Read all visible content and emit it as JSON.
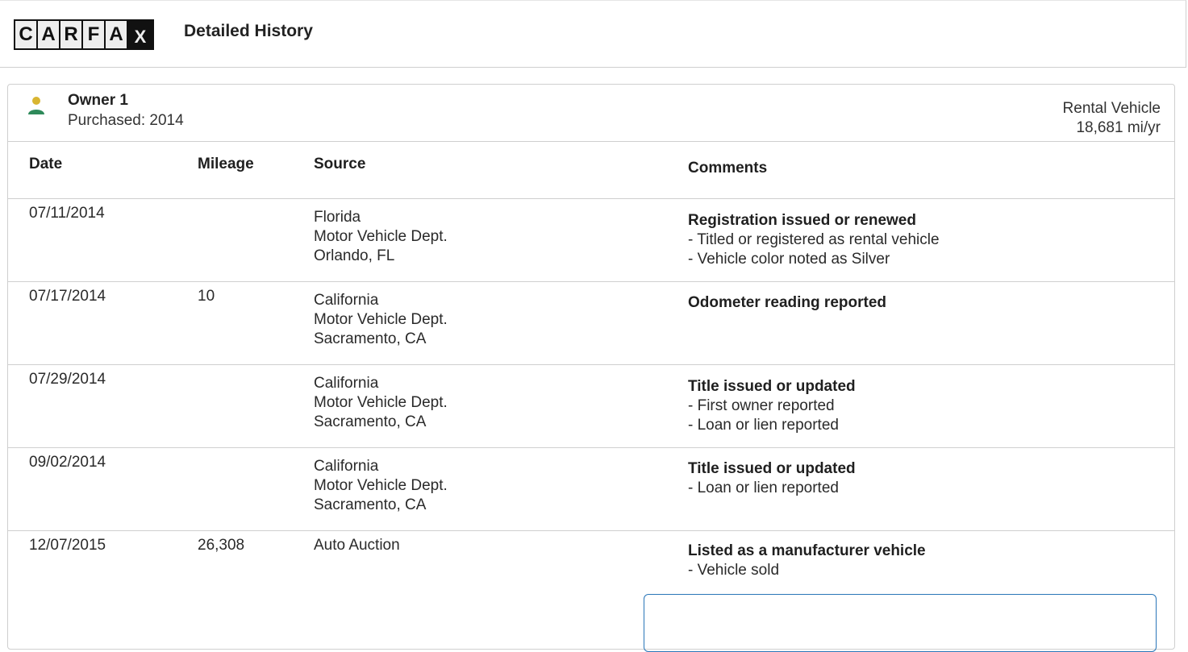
{
  "header": {
    "logo_letters": [
      "C",
      "A",
      "R",
      "F",
      "A",
      "X"
    ],
    "title": "Detailed History"
  },
  "owner": {
    "name": "Owner 1",
    "purchased": "Purchased: 2014",
    "type": "Rental Vehicle",
    "rate": "18,681 mi/yr",
    "icon": "person-icon",
    "icon_colors": {
      "head": "#d9b531",
      "body": "#2e8a5a"
    }
  },
  "table": {
    "columns": [
      "Date",
      "Mileage",
      "Source",
      "Comments"
    ],
    "rows": [
      {
        "date": "07/11/2014",
        "mileage": "",
        "source": [
          "Florida",
          "Motor Vehicle Dept.",
          "Orlando, FL"
        ],
        "comment_title": "Registration issued or renewed",
        "comment_items": [
          "- Titled or registered as rental vehicle",
          "- Vehicle color noted as Silver"
        ]
      },
      {
        "date": "07/17/2014",
        "mileage": "10",
        "source": [
          "California",
          "Motor Vehicle Dept.",
          "Sacramento, CA"
        ],
        "comment_title": "Odometer reading reported",
        "comment_items": []
      },
      {
        "date": "07/29/2014",
        "mileage": "",
        "source": [
          "California",
          "Motor Vehicle Dept.",
          "Sacramento, CA"
        ],
        "comment_title": "Title issued or updated",
        "comment_items": [
          "- First owner reported",
          "- Loan or lien reported"
        ]
      },
      {
        "date": "09/02/2014",
        "mileage": "",
        "source": [
          "California",
          "Motor Vehicle Dept.",
          "Sacramento, CA"
        ],
        "comment_title": "Title issued or updated",
        "comment_items": [
          "- Loan or lien reported"
        ]
      },
      {
        "date": "12/07/2015",
        "mileage": "26,308",
        "source": [
          "Auto Auction"
        ],
        "comment_title": "Listed as a manufacturer vehicle",
        "comment_items": [
          "- Vehicle sold"
        ]
      }
    ]
  },
  "colors": {
    "border": "#cfcfcf",
    "note_box_border": "#2a76b8"
  }
}
